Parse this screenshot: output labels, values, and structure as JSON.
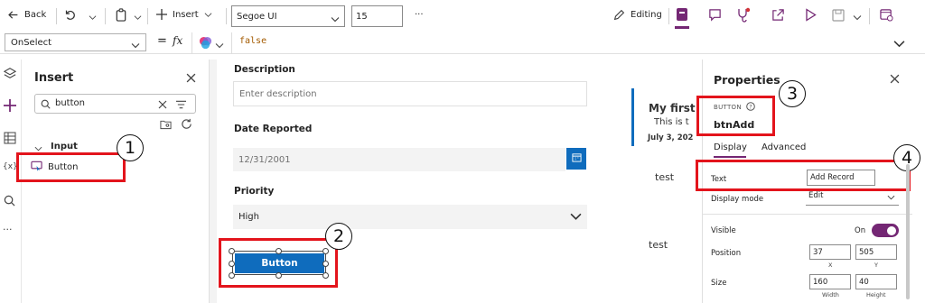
{
  "toolbar": {
    "back_label": "Back",
    "insert_label": "Insert",
    "font_name": "Segoe UI",
    "font_size": "15",
    "more_label": "···",
    "editing_label": "Editing"
  },
  "formula_bar": {
    "property": "OnSelect",
    "equals": "=",
    "fx": "fx",
    "formula": "false"
  },
  "insert_panel": {
    "title": "Insert",
    "search_value": "button",
    "group_label": "Input",
    "item_label": "Button"
  },
  "form": {
    "description_label": "Description",
    "description_placeholder": "Enter description",
    "date_label": "Date Reported",
    "date_value": "12/31/2001",
    "priority_label": "Priority",
    "priority_value": "High",
    "button_label": "Button"
  },
  "gallery": {
    "title": "My first",
    "subtitle": "This is t",
    "date": "July 3, 202",
    "item1": "test",
    "item2": "test"
  },
  "properties": {
    "title": "Properties",
    "control_type": "BUTTON",
    "control_name": "btnAdd",
    "tab_display": "Display",
    "tab_advanced": "Advanced",
    "text_label": "Text",
    "text_value": "Add Record",
    "display_mode_label": "Display mode",
    "display_mode_value": "Edit",
    "visible_label": "Visible",
    "visible_value": "On",
    "position_label": "Position",
    "pos_x": "37",
    "pos_y": "505",
    "x_label": "X",
    "y_label": "Y",
    "size_label": "Size",
    "width": "160",
    "height": "40",
    "width_label": "Width",
    "height_label": "Height"
  },
  "annotations": {
    "one": "1",
    "two": "2",
    "three": "3",
    "four": "4"
  },
  "colors": {
    "accent": "#742774",
    "annotation": "#e3141c",
    "button": "#0f6cbd"
  }
}
